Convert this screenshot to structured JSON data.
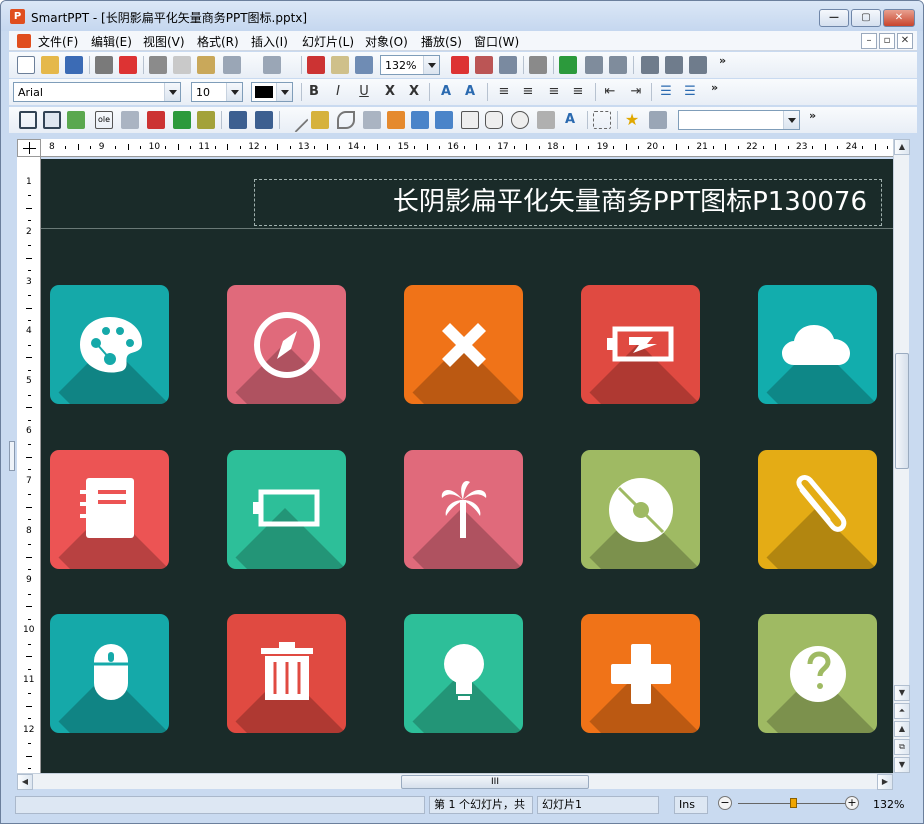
{
  "window": {
    "app_name": "SmartPPT",
    "title": "SmartPPT - [长阴影扁平化矢量商务PPT图标.pptx]"
  },
  "menu": [
    "文件(F)",
    "编辑(E)",
    "视图(V)",
    "格式(R)",
    "插入(I)",
    "幻灯片(L)",
    "对象(O)",
    "播放(S)",
    "窗口(W)"
  ],
  "toolbar": {
    "zoom": "132%",
    "font_name": "Arial",
    "font_size": "10",
    "more_glyph": "»"
  },
  "ruler": {
    "h_labels": [
      "8",
      "9",
      "10",
      "11",
      "12",
      "13",
      "14",
      "15",
      "16",
      "17",
      "18",
      "19",
      "20",
      "21",
      "22",
      "23",
      "24"
    ],
    "v_labels": [
      "1",
      "2",
      "3",
      "4",
      "5",
      "6",
      "7",
      "8",
      "9",
      "10",
      "11",
      "12"
    ]
  },
  "slide": {
    "title": "长阴影扁平化矢量商务PPT图标P130076",
    "background": "#1a2b29",
    "icons": [
      {
        "name": "palette-icon",
        "color": "#15a9a9"
      },
      {
        "name": "compass-icon",
        "color": "#e06a7b"
      },
      {
        "name": "close-x-icon",
        "color": "#f07318"
      },
      {
        "name": "battery-charging-icon",
        "color": "#e04a41"
      },
      {
        "name": "cloud-icon",
        "color": "#12adad"
      },
      {
        "name": "notebook-icon",
        "color": "#ec5454"
      },
      {
        "name": "battery-icon",
        "color": "#2dbf99"
      },
      {
        "name": "palm-tree-icon",
        "color": "#e06a7b"
      },
      {
        "name": "disc-icon",
        "color": "#9fba63"
      },
      {
        "name": "paperclip-icon",
        "color": "#e4ac15"
      },
      {
        "name": "mouse-icon",
        "color": "#15a9a9"
      },
      {
        "name": "trash-icon",
        "color": "#e04a41"
      },
      {
        "name": "lightbulb-icon",
        "color": "#2dbf99"
      },
      {
        "name": "plus-icon",
        "color": "#f07318"
      },
      {
        "name": "help-globe-icon",
        "color": "#9fba63"
      }
    ]
  },
  "status": {
    "slide_of": "第 1 个幻灯片，共",
    "slide_total": "幻灯片1",
    "mode": "Ins",
    "zoom": "132%",
    "zoom_minus": "−",
    "zoom_plus": "+"
  },
  "hscroll_grip": "III"
}
